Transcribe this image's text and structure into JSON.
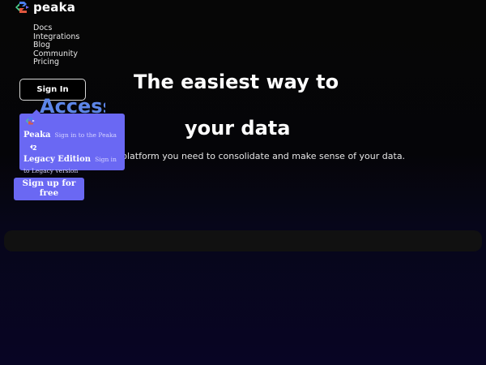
{
  "brand": {
    "name": "peaka",
    "icon": "peaka-logo-icon",
    "colors": {
      "green": "#4cd08e",
      "blue": "#4a7ff0",
      "red": "#e0573e",
      "purple": "#6a68f3",
      "access_blue": "#5d86e8"
    }
  },
  "nav": {
    "items": [
      {
        "label": "Docs"
      },
      {
        "label": "Integrations"
      },
      {
        "label": "Blog"
      },
      {
        "label": "Community"
      },
      {
        "label": "Pricing"
      }
    ]
  },
  "signin_button": {
    "label": "Sign In"
  },
  "signin_menu": {
    "items": [
      {
        "title": "Peaka",
        "description": "Sign in to the Peaka",
        "icon": "peaka-logo-icon"
      },
      {
        "title": "Legacy Edition",
        "description": "Sign in to Legacy version",
        "icon": "legacy-logo-icon"
      }
    ]
  },
  "signup_button": {
    "label_line1": "Sign up for",
    "label_line2": "free"
  },
  "hero": {
    "line1": "The easiest way to",
    "overlap_word": "Access",
    "line2": "your data",
    "subtitle": "platform you need to consolidate and make sense of your data."
  }
}
